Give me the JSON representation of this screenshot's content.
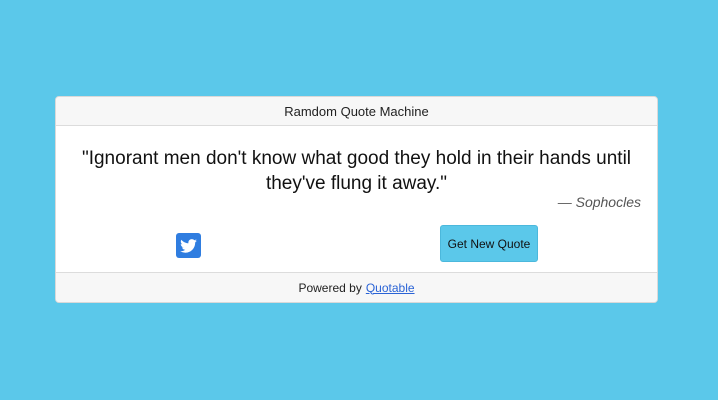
{
  "header": {
    "title": "Ramdom Quote Machine"
  },
  "quote": {
    "text": "\"Ignorant men don't know what good they hold in their hands until they've flung it away.\"",
    "author": "— Sophocles"
  },
  "actions": {
    "twitter_icon": "twitter-icon",
    "new_quote_label": "Get New Quote"
  },
  "footer": {
    "powered_by": "Powered by",
    "link_label": "Quotable"
  },
  "colors": {
    "background": "#5bc8ea",
    "button": "#5bc8ea",
    "twitter": "#2f7de0",
    "link": "#2a63d6"
  }
}
